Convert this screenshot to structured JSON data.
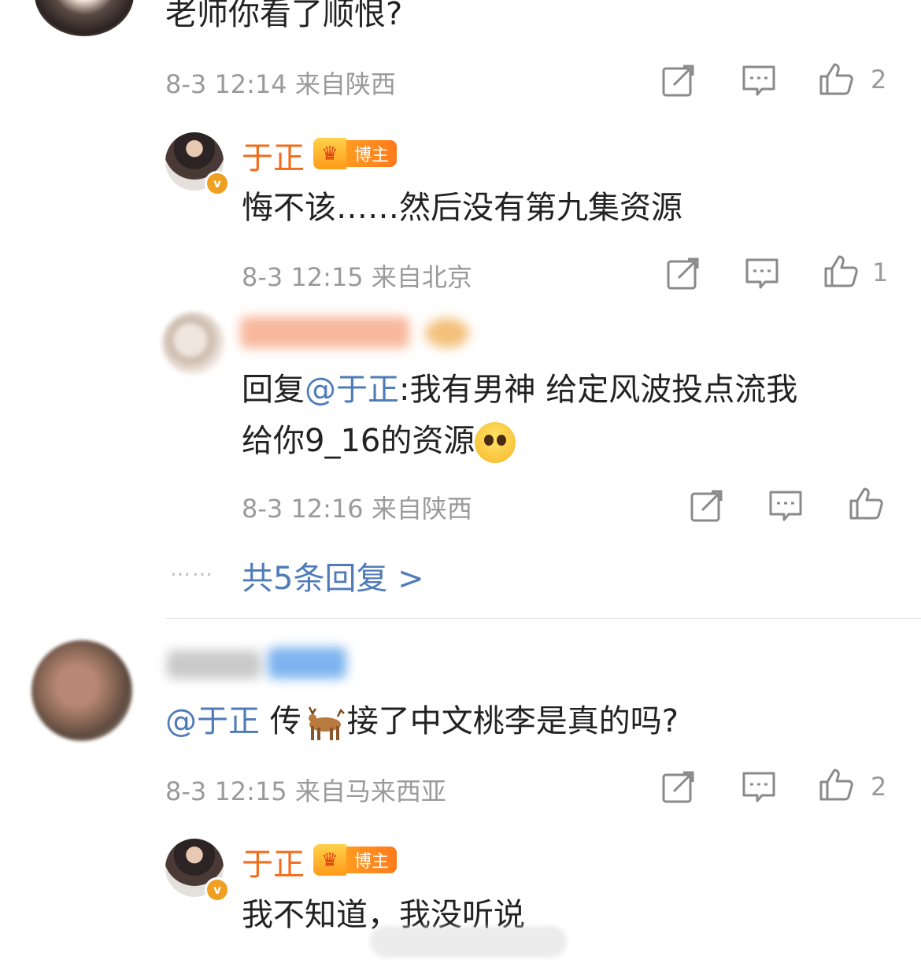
{
  "comment1": {
    "text": "老师你看了顺恨?",
    "time": "8-3 12:14",
    "location": "来自陕西",
    "like_count": "2"
  },
  "reply1": {
    "name": "于正",
    "badge": "博主",
    "text": "悔不该……然后没有第九集资源",
    "time": "8-3 12:15",
    "location": "来自北京",
    "like_count": "1"
  },
  "reply2": {
    "prefix": "回复",
    "mention": "@于正",
    "line1": ":我有男神 给定风波投点流我",
    "line2": "给你9_16的资源",
    "time": "8-3 12:16",
    "location": "来自陕西"
  },
  "more_replies": {
    "dots": "……",
    "label": "共5条回复 >"
  },
  "comment2": {
    "mention": "@于正",
    "text_before": "传",
    "text_after": "接了中文桃李是真的吗?",
    "time": "8-3 12:15",
    "location": "来自马来西亚",
    "like_count": "2"
  },
  "reply3": {
    "name": "于正",
    "badge": "博主",
    "text": "我不知道，我没听说"
  },
  "colors": {
    "accent_orange": "#f26c1b",
    "link_blue": "#4f7cb8",
    "meta_gray": "#9a9a9a"
  },
  "icons": [
    "share-icon",
    "comment-icon",
    "like-icon",
    "crown-icon",
    "verified-icon",
    "deer-emoji",
    "pleading-emoji"
  ]
}
